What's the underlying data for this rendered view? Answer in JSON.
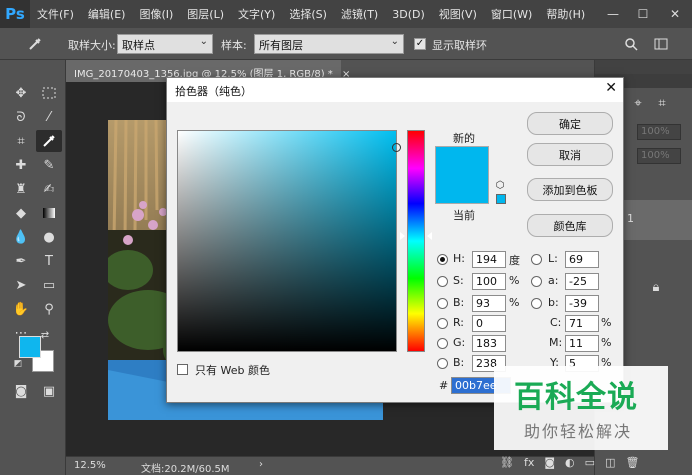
{
  "menubar": {
    "logo": "Ps",
    "items": [
      "文件(F)",
      "编辑(E)",
      "图像(I)",
      "图层(L)",
      "文字(Y)",
      "选择(S)",
      "滤镜(T)",
      "3D(D)",
      "视图(V)",
      "窗口(W)",
      "帮助(H)"
    ],
    "minimize": "—",
    "maximize": "☐",
    "close": "✕"
  },
  "options": {
    "sample_size_label": "取样大小:",
    "sample_size_value": "取样点",
    "sample_label": "样本:",
    "sample_value": "所有图层",
    "show_ring_label": "显示取样环",
    "show_ring_checked": "✓"
  },
  "document": {
    "tab_title": "IMG_20170403_1356.jpg @ 12.5% (图层 1, RGB/8) *",
    "tab_close": "×",
    "zoom": "12.5%",
    "doc_info": "文档:20.2M/60.5M",
    "status_arrow": "›"
  },
  "panels": {
    "opacity_1": "100%",
    "opacity_2": "100%",
    "layer_number": "1",
    "bottom_icons": [
      "link-icon",
      "fx-icon",
      "mask-icon",
      "adjustment-icon",
      "folder-icon",
      "new-layer-icon",
      "trash-icon"
    ]
  },
  "color_picker": {
    "title": "拾色器（纯色）",
    "close": "✕",
    "new_label": "新的",
    "current_label": "当前",
    "color_hex": "#00b7ee",
    "buttons": {
      "ok": "确定",
      "cancel": "取消",
      "add_to_swatches": "添加到色板",
      "color_libraries": "颜色库"
    },
    "hsb": {
      "h_label": "H:",
      "h": "194",
      "h_unit": "度",
      "s_label": "S:",
      "s": "100",
      "s_unit": "%",
      "b_label": "B:",
      "b": "93",
      "b_unit": "%"
    },
    "rgb": {
      "r_label": "R:",
      "r": "0",
      "g_label": "G:",
      "g": "183",
      "b_label": "B:",
      "b": "238"
    },
    "lab": {
      "l_label": "L:",
      "l": "69",
      "a_label": "a:",
      "a": "-25",
      "b_label": "b:",
      "b": "-39"
    },
    "cmyk": {
      "c_label": "C:",
      "c": "71",
      "m_label": "M:",
      "m": "11",
      "y_label": "Y:",
      "y": "5",
      "unit": "%"
    },
    "hex_label": "#",
    "hex": "00b7ee",
    "web_only_label": "只有 Web 颜色"
  },
  "watermark": {
    "title": "百科全说",
    "subtitle": "助你轻松解决"
  },
  "tools": {
    "foreground_color": "#0fb6ee",
    "background_color": "#ffffff"
  }
}
